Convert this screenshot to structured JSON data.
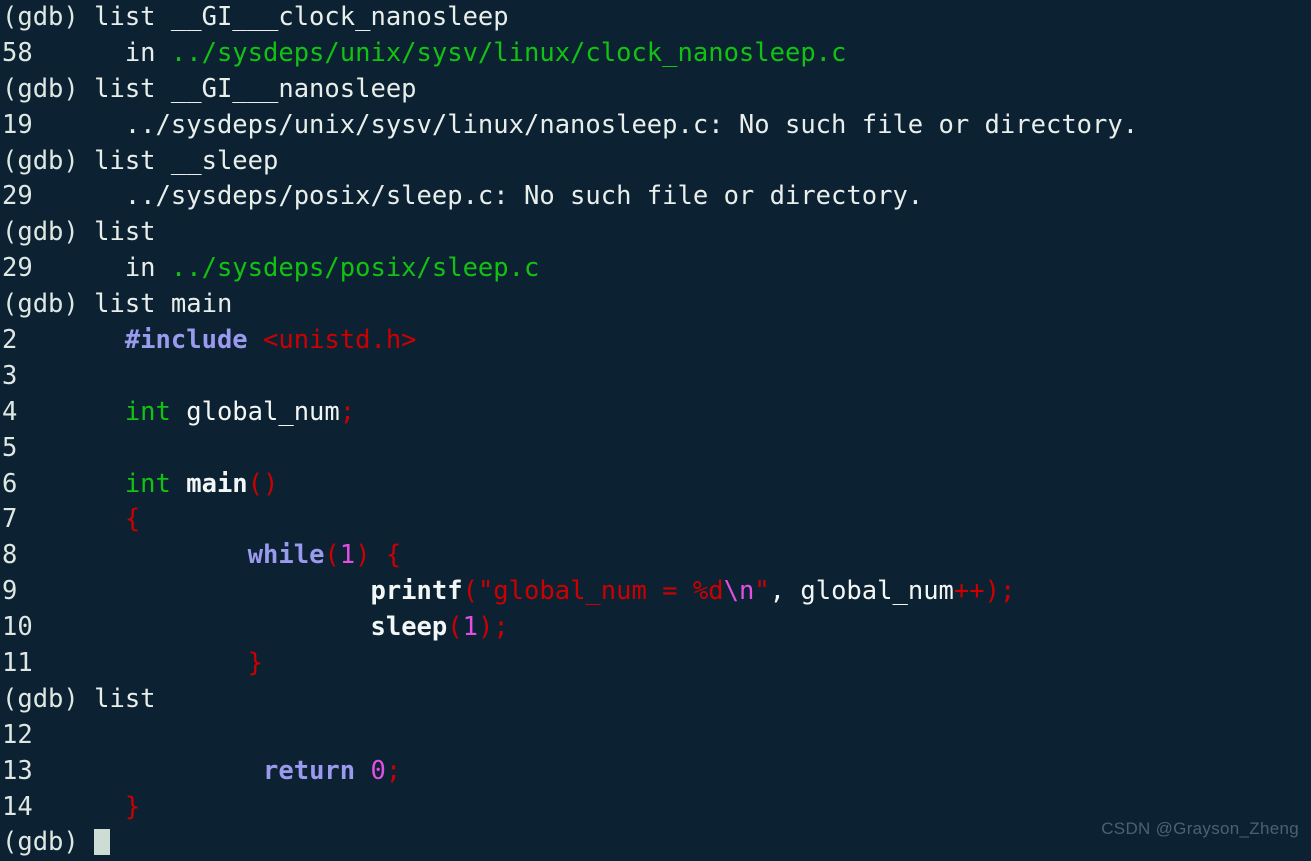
{
  "terminal": {
    "app": "gdb",
    "background_color": "#0c2233",
    "foreground_color": "#e8eeea",
    "watermark": "CSDN @Grayson_Zheng",
    "cursor": {
      "shape": "block",
      "color": "#cdddd3",
      "visible": true
    },
    "palette": {
      "default": "#e8eeea",
      "green": "#12c212",
      "red": "#cc0000",
      "violet": "#9a9aee",
      "magenta": "#e24fe2",
      "white": "#f2f6f4",
      "dim": "#dfe7e3"
    }
  },
  "lines": [
    {
      "id": "line-0",
      "kind": "prompt",
      "spans": [
        {
          "text": "(gdb) ",
          "style": "fg-dim"
        },
        {
          "text": "list __GI___clock_nanosleep",
          "style": "fg-default"
        }
      ]
    },
    {
      "id": "line-1",
      "kind": "source-location",
      "spans": [
        {
          "text": "58",
          "style": "fg-dim"
        },
        {
          "text": "      in ",
          "style": "fg-default"
        },
        {
          "text": "../sysdeps/unix/sysv/linux/clock_nanosleep.c",
          "style": "fg-green"
        }
      ]
    },
    {
      "id": "line-2",
      "kind": "prompt",
      "spans": [
        {
          "text": "(gdb) ",
          "style": "fg-dim"
        },
        {
          "text": "list __GI___nanosleep",
          "style": "fg-default"
        }
      ]
    },
    {
      "id": "line-3",
      "kind": "error",
      "spans": [
        {
          "text": "19",
          "style": "fg-dim"
        },
        {
          "text": "      ../sysdeps/unix/sysv/linux/nanosleep.c: No such file or directory.",
          "style": "fg-default"
        }
      ]
    },
    {
      "id": "line-4",
      "kind": "prompt",
      "spans": [
        {
          "text": "(gdb) ",
          "style": "fg-dim"
        },
        {
          "text": "list __sleep",
          "style": "fg-default"
        }
      ]
    },
    {
      "id": "line-5",
      "kind": "error",
      "spans": [
        {
          "text": "29",
          "style": "fg-dim"
        },
        {
          "text": "      ../sysdeps/posix/sleep.c: No such file or directory.",
          "style": "fg-default"
        }
      ]
    },
    {
      "id": "line-6",
      "kind": "prompt",
      "spans": [
        {
          "text": "(gdb) ",
          "style": "fg-dim"
        },
        {
          "text": "list",
          "style": "fg-default"
        }
      ]
    },
    {
      "id": "line-7",
      "kind": "source-location",
      "spans": [
        {
          "text": "29",
          "style": "fg-dim"
        },
        {
          "text": "      in ",
          "style": "fg-default"
        },
        {
          "text": "../sysdeps/posix/sleep.c",
          "style": "fg-green"
        }
      ]
    },
    {
      "id": "line-8",
      "kind": "prompt",
      "spans": [
        {
          "text": "(gdb) ",
          "style": "fg-dim"
        },
        {
          "text": "list main",
          "style": "fg-default"
        }
      ]
    },
    {
      "id": "line-9",
      "kind": "code",
      "spans": [
        {
          "text": "2",
          "style": "fg-dim"
        },
        {
          "text": "       ",
          "style": "fg-default"
        },
        {
          "text": "#include",
          "style": "fg-violet b"
        },
        {
          "text": " ",
          "style": "fg-default"
        },
        {
          "text": "<unistd.h>",
          "style": "fg-red"
        }
      ]
    },
    {
      "id": "line-10",
      "kind": "code",
      "spans": [
        {
          "text": "3",
          "style": "fg-dim"
        }
      ]
    },
    {
      "id": "line-11",
      "kind": "code",
      "spans": [
        {
          "text": "4",
          "style": "fg-dim"
        },
        {
          "text": "       ",
          "style": "fg-default"
        },
        {
          "text": "int",
          "style": "fg-kwgreen"
        },
        {
          "text": " global_num",
          "style": "fg-white"
        },
        {
          "text": ";",
          "style": "fg-red"
        }
      ]
    },
    {
      "id": "line-12",
      "kind": "code",
      "spans": [
        {
          "text": "5",
          "style": "fg-dim"
        }
      ]
    },
    {
      "id": "line-13",
      "kind": "code",
      "spans": [
        {
          "text": "6",
          "style": "fg-dim"
        },
        {
          "text": "       ",
          "style": "fg-default"
        },
        {
          "text": "int",
          "style": "fg-kwgreen"
        },
        {
          "text": " ",
          "style": "fg-default"
        },
        {
          "text": "main",
          "style": "fg-white b"
        },
        {
          "text": "()",
          "style": "fg-red"
        }
      ]
    },
    {
      "id": "line-14",
      "kind": "code",
      "spans": [
        {
          "text": "7",
          "style": "fg-dim"
        },
        {
          "text": "       ",
          "style": "fg-default"
        },
        {
          "text": "{",
          "style": "fg-red"
        }
      ]
    },
    {
      "id": "line-15",
      "kind": "code",
      "spans": [
        {
          "text": "8",
          "style": "fg-dim"
        },
        {
          "text": "               ",
          "style": "fg-default"
        },
        {
          "text": "while",
          "style": "fg-violet b"
        },
        {
          "text": "(",
          "style": "fg-red"
        },
        {
          "text": "1",
          "style": "fg-magenta"
        },
        {
          "text": ")",
          "style": "fg-red"
        },
        {
          "text": " ",
          "style": "fg-default"
        },
        {
          "text": "{",
          "style": "fg-red"
        }
      ]
    },
    {
      "id": "line-16",
      "kind": "code",
      "spans": [
        {
          "text": "9",
          "style": "fg-dim"
        },
        {
          "text": "                       ",
          "style": "fg-default"
        },
        {
          "text": "printf",
          "style": "fg-white b"
        },
        {
          "text": "(",
          "style": "fg-red"
        },
        {
          "text": "\"global_num = %d",
          "style": "fg-red"
        },
        {
          "text": "\\n",
          "style": "fg-magenta"
        },
        {
          "text": "\"",
          "style": "fg-red"
        },
        {
          "text": ", global_num",
          "style": "fg-white"
        },
        {
          "text": "++);",
          "style": "fg-red"
        }
      ]
    },
    {
      "id": "line-17",
      "kind": "code",
      "spans": [
        {
          "text": "10",
          "style": "fg-dim"
        },
        {
          "text": "                      ",
          "style": "fg-default"
        },
        {
          "text": "sleep",
          "style": "fg-white b"
        },
        {
          "text": "(",
          "style": "fg-red"
        },
        {
          "text": "1",
          "style": "fg-magenta"
        },
        {
          "text": ");",
          "style": "fg-red"
        }
      ]
    },
    {
      "id": "line-18",
      "kind": "code",
      "spans": [
        {
          "text": "11",
          "style": "fg-dim"
        },
        {
          "text": "              ",
          "style": "fg-default"
        },
        {
          "text": "}",
          "style": "fg-red"
        }
      ]
    },
    {
      "id": "line-19",
      "kind": "prompt",
      "spans": [
        {
          "text": "(gdb) ",
          "style": "fg-dim"
        },
        {
          "text": "list",
          "style": "fg-default"
        }
      ]
    },
    {
      "id": "line-20",
      "kind": "code",
      "spans": [
        {
          "text": "12",
          "style": "fg-dim"
        }
      ]
    },
    {
      "id": "line-21",
      "kind": "code",
      "spans": [
        {
          "text": "13",
          "style": "fg-dim"
        },
        {
          "text": "               ",
          "style": "fg-default"
        },
        {
          "text": "return",
          "style": "fg-violet b"
        },
        {
          "text": " ",
          "style": "fg-default"
        },
        {
          "text": "0",
          "style": "fg-magenta"
        },
        {
          "text": ";",
          "style": "fg-red"
        }
      ]
    },
    {
      "id": "line-22",
      "kind": "code",
      "spans": [
        {
          "text": "14",
          "style": "fg-dim"
        },
        {
          "text": "      ",
          "style": "fg-default"
        },
        {
          "text": "}",
          "style": "fg-red"
        }
      ]
    },
    {
      "id": "line-23",
      "kind": "prompt-cursor",
      "spans": [
        {
          "text": "(gdb) ",
          "style": "fg-dim"
        }
      ],
      "has_cursor": true
    }
  ]
}
